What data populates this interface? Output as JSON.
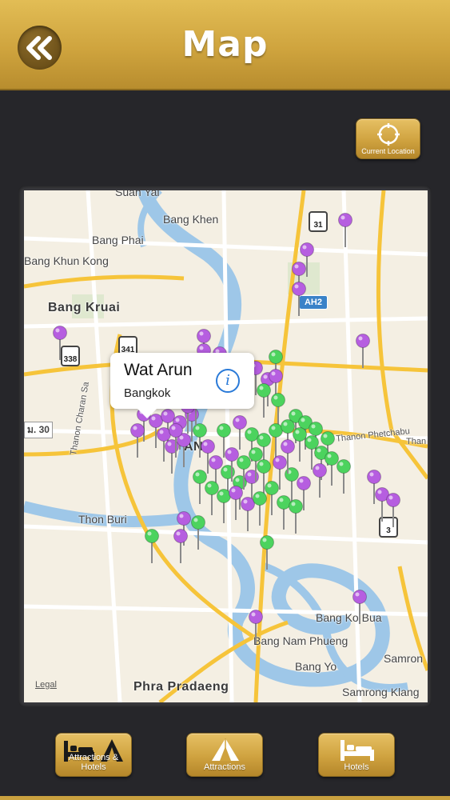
{
  "header": {
    "title": "Map",
    "back_icon": "double-chevron-left-icon"
  },
  "current_location": {
    "label": "Current Location",
    "icon": "crosshair-icon"
  },
  "map": {
    "places": [
      "Suan Yai",
      "Bang Khen",
      "Bang Phai",
      "Bang Khun Kong",
      "Bang Kruai",
      "Thon Buri",
      "Bang Ko Bua",
      "Bang Nam Phueng",
      "Bang Yo",
      "Samron",
      "Phra Pradaeng",
      "Samrong Klang"
    ],
    "streets": [
      "Thanon Charan Sa",
      "Thanon Phetchabu",
      "Than"
    ],
    "route_shields": [
      "31",
      "341",
      "338",
      "3"
    ],
    "asian_highway": "AH2",
    "road_label": "ม. 30",
    "partial_city": "ANG",
    "legal": "Legal",
    "callout": {
      "title": "Wat Arun",
      "subtitle": "Bangkok",
      "info_icon": "info-icon"
    },
    "colors": {
      "attraction_pin": "#b65ee0",
      "hotel_pin": "#4cd35e",
      "water": "#9ec7e8",
      "major_road": "#f6c43a"
    }
  },
  "tabs": [
    {
      "label": "Attractions & Hotels",
      "icon": "bed-and-tent-icon"
    },
    {
      "label": "Attractions",
      "icon": "tent-icon"
    },
    {
      "label": "Hotels",
      "icon": "bed-icon"
    }
  ]
}
